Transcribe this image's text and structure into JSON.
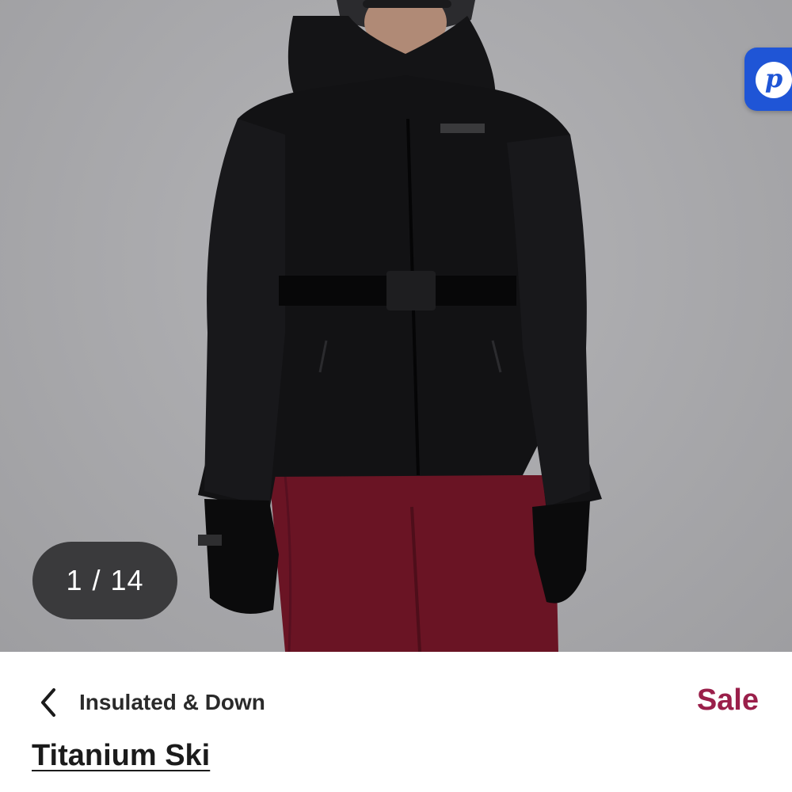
{
  "gallery": {
    "current": "1",
    "separator": "/",
    "total": "14",
    "image_alt": "Woman wearing black Columbia Titanium insulated ski jacket with belt and burgundy ski pants"
  },
  "chat_badge": {
    "glyph": "p"
  },
  "breadcrumb": {
    "label": "Insulated & Down"
  },
  "badge": {
    "label": "Sale",
    "color": "#9a1f4a"
  },
  "product": {
    "title": "Titanium Ski"
  }
}
